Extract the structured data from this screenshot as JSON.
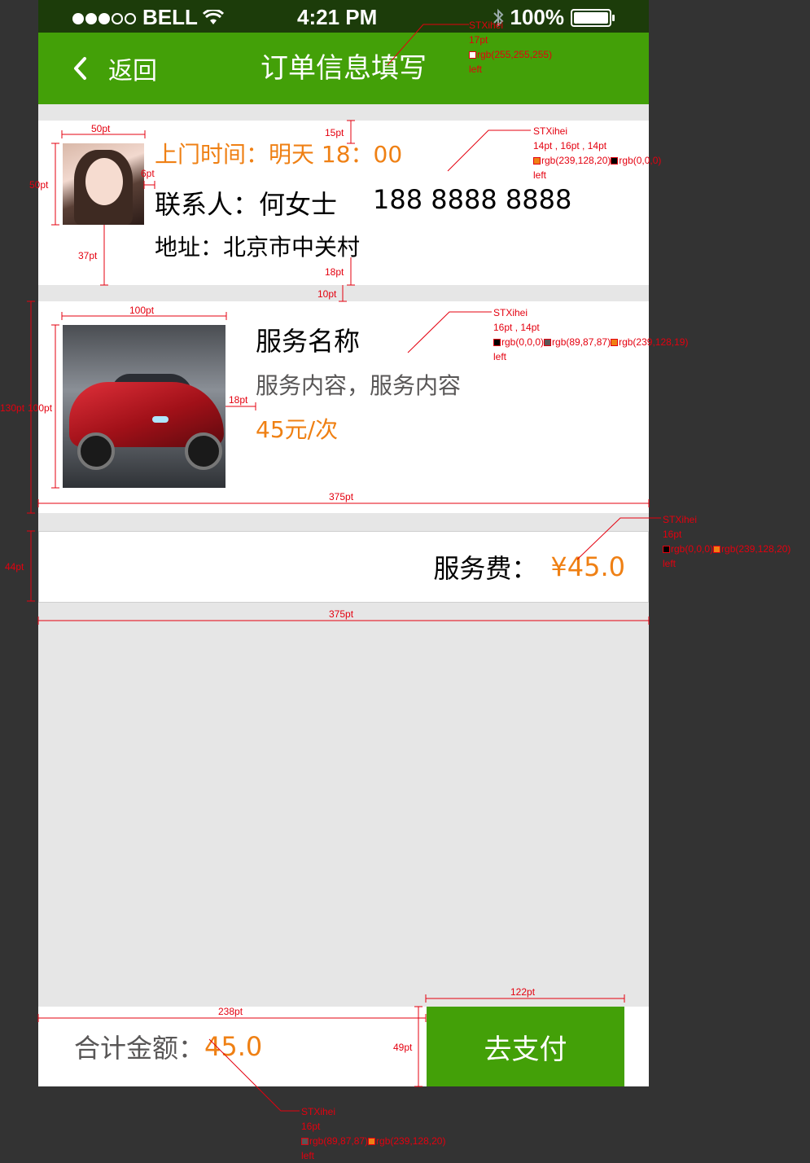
{
  "status_bar": {
    "carrier": "BELL",
    "time": "4:21 PM",
    "battery": "100%"
  },
  "nav": {
    "back_label": "返回",
    "title": "订单信息填写"
  },
  "order": {
    "visit_time": "上门时间：明天 18：00",
    "contact": "联系人：何女士",
    "phone": "188 8888 8888",
    "address": "地址：北京市中关村"
  },
  "service": {
    "name": "服务名称",
    "description": "服务内容，服务内容",
    "price": "45元/次"
  },
  "fee": {
    "label": "服务费：",
    "value": "¥45.0"
  },
  "footer": {
    "total_label": "合计金额：",
    "total_value": "45.0",
    "pay_label": "去支付"
  },
  "colors": {
    "green": "#43a008",
    "orange": "#ef8014",
    "gray_text": "#595757",
    "annotation": "#e4000f"
  },
  "annotations": {
    "a1": {
      "font": "STXihei",
      "size": "17pt",
      "color1": "rgb(255,255,255)",
      "align": "left"
    },
    "a2": {
      "font": "STXihei",
      "size": "14pt , 16pt , 14pt",
      "color1": "rgb(239,128,20)",
      "color2": "rgb(0,0,0)",
      "align": "left"
    },
    "a3": {
      "font": "STXihei",
      "size": "16pt , 14pt",
      "color1": "rgb(0,0,0)",
      "color2": "rgb(89,87,87)",
      "color3": "rgb(239,128,19)",
      "align": "left"
    },
    "a4": {
      "font": "STXihei",
      "size": "16pt",
      "color1": "rgb(0,0,0)",
      "color2": "rgb(239,128,20)",
      "align": "left"
    },
    "a5": {
      "font": "STXihei",
      "size": "16pt",
      "color1": "rgb(89,87,87)",
      "color2": "rgb(239,128,20)",
      "align": "left"
    },
    "dims": {
      "d50w": "50pt",
      "d50h": "50pt",
      "d6": "6pt",
      "d15": "15pt",
      "d37": "37pt",
      "d18a": "18pt",
      "d10": "10pt",
      "d100w": "100pt",
      "d130": "130pt",
      "d100h": "100pt",
      "d18b": "18pt",
      "d375a": "375pt",
      "d44": "44pt",
      "d375b": "375pt",
      "d238": "238pt",
      "d49": "49pt",
      "d122": "122pt"
    }
  }
}
